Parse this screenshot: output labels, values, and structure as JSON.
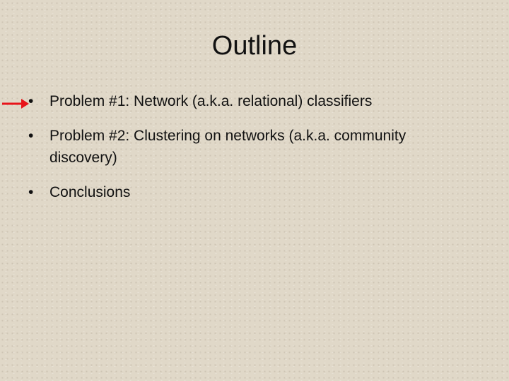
{
  "slide": {
    "title": "Outline",
    "bullets": [
      "Problem #1: Network (a.k.a. relational) classifiers",
      "Problem #2: Clustering on networks (a.k.a. community discovery)",
      "Conclusions"
    ],
    "pointer_color": "#e8141a",
    "current_item": 0
  }
}
